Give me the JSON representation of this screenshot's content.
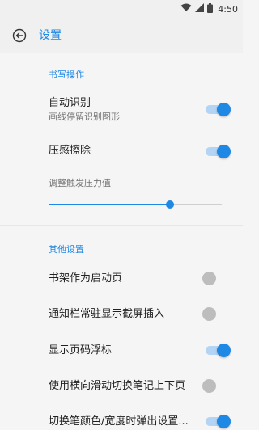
{
  "status_bar": {
    "time": "4:50",
    "icons": [
      "wifi-icon",
      "signal-icon",
      "battery-icon"
    ]
  },
  "app_bar": {
    "back_icon": "back-arrow-icon",
    "title": "设置"
  },
  "sections": {
    "writing": {
      "header": "书写操作",
      "auto_recognize": {
        "title": "自动识别",
        "subtitle": "画线停留识别图形",
        "enabled": true
      },
      "pressure_erase": {
        "title": "压感擦除",
        "enabled": true
      },
      "pressure_slider": {
        "label": "调整触发压力值",
        "value_fraction": 0.7
      }
    },
    "other": {
      "header": "其他设置",
      "bookshelf_start": {
        "title": "书架作为启动页",
        "enabled": false
      },
      "notification_screenshot": {
        "title": "通知栏常驻显示截屏插入",
        "enabled": false
      },
      "page_float": {
        "title": "显示页码浮标",
        "enabled": true
      },
      "swipe_pages": {
        "title": "使用横向滑动切换笔记上下页",
        "enabled": false
      },
      "pen_popup": {
        "title": "切换笔颜色/宽度时弹出设置...",
        "enabled": true
      }
    }
  },
  "colors": {
    "accent": "#1e88e5",
    "toggle_off": "#bdbdbd"
  }
}
